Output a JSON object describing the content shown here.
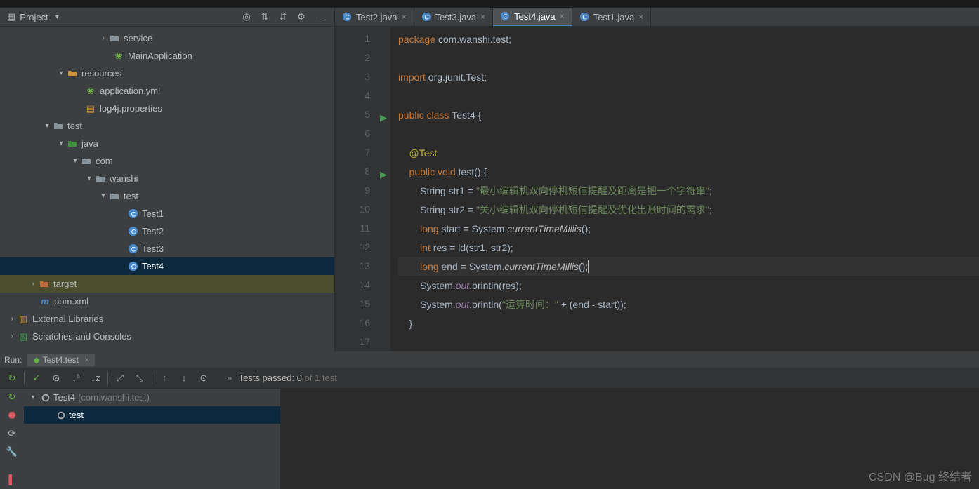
{
  "project": {
    "title": "Project",
    "tree": {
      "service": "service",
      "mainApp": "MainApplication",
      "resources": "resources",
      "appYml": "application.yml",
      "log4j": "log4j.properties",
      "test": "test",
      "java": "java",
      "com": "com",
      "wanshi": "wanshi",
      "testPkg": "test",
      "test1": "Test1",
      "test2": "Test2",
      "test3": "Test3",
      "test4": "Test4",
      "target": "target",
      "pom": "pom.xml",
      "extLib": "External Libraries",
      "scratches": "Scratches and Consoles"
    }
  },
  "tabs": {
    "t1": "Test2.java",
    "t2": "Test3.java",
    "t3": "Test4.java",
    "t4": "Test1.java"
  },
  "editor": {
    "lineNums": [
      "1",
      "2",
      "3",
      "4",
      "5",
      "6",
      "7",
      "8",
      "9",
      "10",
      "11",
      "12",
      "13",
      "14",
      "15",
      "16",
      "17"
    ],
    "l1a": "package ",
    "l1b": "com.wanshi.test;",
    "l3a": "import ",
    "l3b": "org.junit.Test;",
    "l5a": "public class ",
    "l5b": "Test4 {",
    "l7": "    @Test",
    "l8a": "    public void ",
    "l8b": "test() {",
    "l9a": "        String str1 = ",
    "l9b": "\"最小编辑机双向停机短信提醒及距离是把一个字符串\"",
    "l9c": ";",
    "l10a": "        String str2 = ",
    "l10b": "\"关小编辑机双向停机短信提醒及优化出账时间的需求\"",
    "l10c": ";",
    "l11a": "        long ",
    "l11b": "start = System.",
    "l11c": "currentTimeMillis",
    "l11d": "();",
    "l12a": "        int ",
    "l12b": "res = ld(str1, str2);",
    "l13a": "        long ",
    "l13b": "end = System.",
    "l13c": "currentTimeMillis",
    "l13d": "();",
    "l14a": "        System.",
    "l14b": "out",
    "l14c": ".println(res);",
    "l15a": "        System.",
    "l15b": "out",
    "l15c": ".println(",
    "l15d": "\"运算时间：\"",
    "l15e": " + (end - start));",
    "l16": "    }"
  },
  "run": {
    "label": "Run:",
    "tabName": "Test4.test",
    "statusPrefix": "Tests passed: 0",
    "statusSuffix": " of 1 test",
    "treeRoot": "Test4",
    "treeRootPkg": "(com.wanshi.test)",
    "treeChild": "test"
  },
  "watermark": "CSDN @Bug 终结者"
}
